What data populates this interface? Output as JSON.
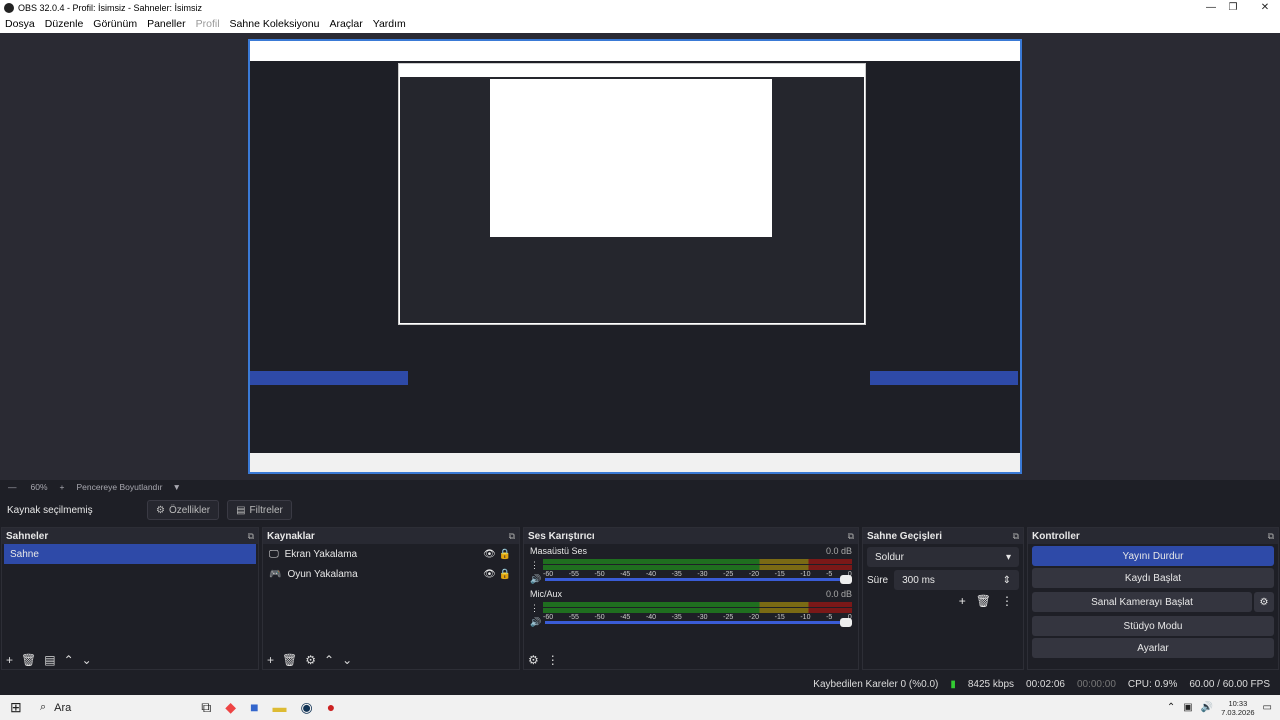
{
  "window": {
    "title": "OBS 32.0.4 - Profil: İsimsiz - Sahneler: İsimsiz"
  },
  "menu": [
    "Dosya",
    "Düzenle",
    "Görünüm",
    "Paneller",
    "Profil",
    "Sahne Koleksiyonu",
    "Araçlar",
    "Yardım"
  ],
  "zoom": {
    "level": "60%",
    "fit": "Pencereye Boyutlandır"
  },
  "propbar": {
    "status": "Kaynak seçilmemiş",
    "properties": "Özellikler",
    "filters": "Filtreler"
  },
  "scenes": {
    "title": "Sahneler",
    "items": [
      "Sahne"
    ]
  },
  "sources": {
    "title": "Kaynaklar",
    "items": [
      "Ekran Yakalama",
      "Oyun Yakalama"
    ]
  },
  "mixer": {
    "title": "Ses Karıştırıcı",
    "channels": [
      {
        "name": "Masaüstü Ses",
        "db": "0.0 dB"
      },
      {
        "name": "Mic/Aux",
        "db": "0.0 dB"
      }
    ],
    "ticks": [
      "-60",
      "-55",
      "-50",
      "-45",
      "-40",
      "-35",
      "-30",
      "-25",
      "-20",
      "-15",
      "-10",
      "-5",
      "0"
    ]
  },
  "transitions": {
    "title": "Sahne Geçişleri",
    "type": "Soldur",
    "duration_label": "Süre",
    "duration": "300 ms"
  },
  "controls": {
    "title": "Kontroller",
    "buttons": [
      "Yayını Durdur",
      "Kaydı Başlat",
      "Sanal Kamerayı Başlat",
      "Stüdyo Modu",
      "Ayarlar"
    ]
  },
  "status": {
    "dropped": "Kaybedilen Kareler 0 (%0.0)",
    "bitrate": "8425 kbps",
    "stream_time": "00:02:06",
    "rec_time": "00:00:00",
    "cpu": "CPU: 0.9%",
    "fps": "60.00 / 60.00 FPS"
  },
  "taskbar": {
    "search": "Ara",
    "time": "10:33",
    "date": "7.03.2026"
  }
}
